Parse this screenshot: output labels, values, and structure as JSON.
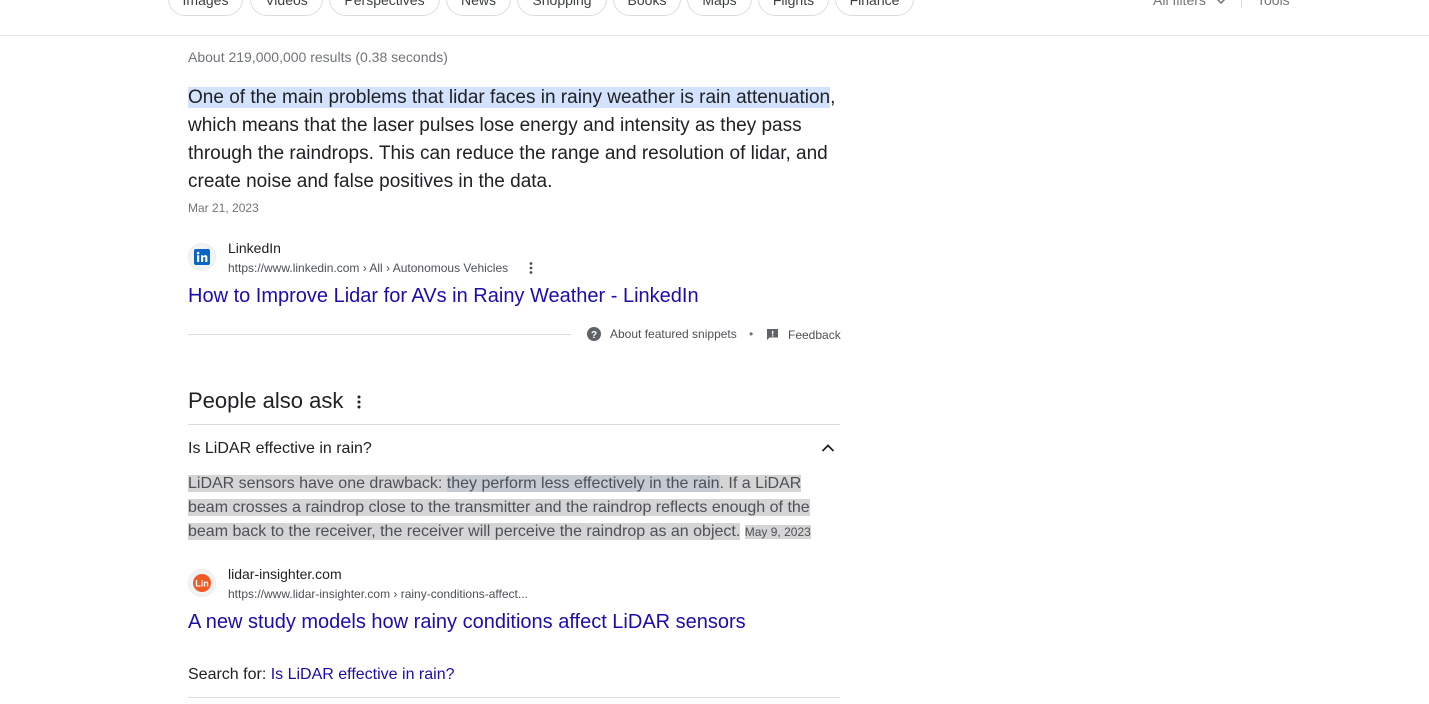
{
  "tabs": [
    {
      "label": "Images"
    },
    {
      "label": "Videos"
    },
    {
      "label": "Perspectives"
    },
    {
      "label": "News"
    },
    {
      "label": "Shopping"
    },
    {
      "label": "Books"
    },
    {
      "label": "Maps"
    },
    {
      "label": "Flights"
    },
    {
      "label": "Finance"
    }
  ],
  "tools": {
    "all_filters": "All filters",
    "tools": "Tools"
  },
  "result_stats": "About 219,000,000 results (0.38 seconds)",
  "featured_snippet": {
    "highlighted_text": "One of the main problems that lidar faces in rainy weather is rain attenuation",
    "rest_text": ", which means that the laser pulses lose energy and intensity as they pass through the raindrops. This can reduce the range and resolution of lidar, and create noise and false positives in the data.",
    "date": "Mar 21, 2023",
    "source": {
      "site_name": "LinkedIn",
      "url": "https://www.linkedin.com › All › Autonomous Vehicles",
      "title": "How to Improve Lidar for AVs in Rainy Weather - LinkedIn",
      "favicon_icon": "linkedin-icon"
    },
    "footer": {
      "about": "About featured snippets",
      "separator": "•",
      "feedback": "Feedback"
    }
  },
  "people_also_ask": {
    "heading": "People also ask",
    "question": "Is LiDAR effective in rain?",
    "answer": {
      "part1": "LiDAR sensors have one drawback: ",
      "highlight": "they perform less effectively in the rain",
      "part2": ". If a LiDAR beam crosses a raindrop close to the transmitter and the raindrop reflects enough of the beam back to the receiver, the receiver will perceive the raindrop as an object.",
      "date": "May 9, 2023"
    },
    "source": {
      "site_name": "lidar-insighter.com",
      "url": "https://www.lidar-insighter.com › rainy-conditions-affect...",
      "title": "A new study models how rainy conditions affect LiDAR sensors",
      "favicon_icon": "lidar-insighter-icon"
    },
    "search_for_label": "Search for: ",
    "search_for_query": "Is LiDAR effective in rain?"
  },
  "colors": {
    "link": "#1a0dab",
    "highlight_blue": "#d3e3fd",
    "highlight_grey": "#d5d5d5",
    "linkedin": "#0a66c2",
    "lidar_insighter": "#f15a24"
  }
}
